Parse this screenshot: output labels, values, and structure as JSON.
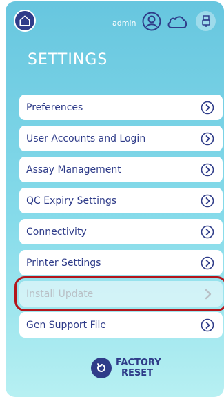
{
  "header": {
    "user_name": "admin",
    "icons": [
      "home-icon",
      "user-icon",
      "cloud-icon",
      "usb-icon"
    ]
  },
  "page": {
    "title": "SETTINGS"
  },
  "menu": {
    "items": [
      {
        "label": "Preferences",
        "enabled": true
      },
      {
        "label": "User Accounts and Login",
        "enabled": true
      },
      {
        "label": "Assay Management",
        "enabled": true
      },
      {
        "label": "QC Expiry Settings",
        "enabled": true
      },
      {
        "label": "Connectivity",
        "enabled": true
      },
      {
        "label": "Printer Settings",
        "enabled": true
      },
      {
        "label": "Install Update",
        "enabled": false,
        "highlighted": true
      },
      {
        "label": "Gen Support File",
        "enabled": true
      }
    ]
  },
  "footer": {
    "factory_reset_line1": "FACTORY",
    "factory_reset_line2": "RESET"
  },
  "colors": {
    "primary": "#2f3c89",
    "background_top": "#67c6df",
    "background_bottom": "#b7f0f2",
    "highlight_border": "#b3151b",
    "disabled_text": "#b9c0c6"
  }
}
